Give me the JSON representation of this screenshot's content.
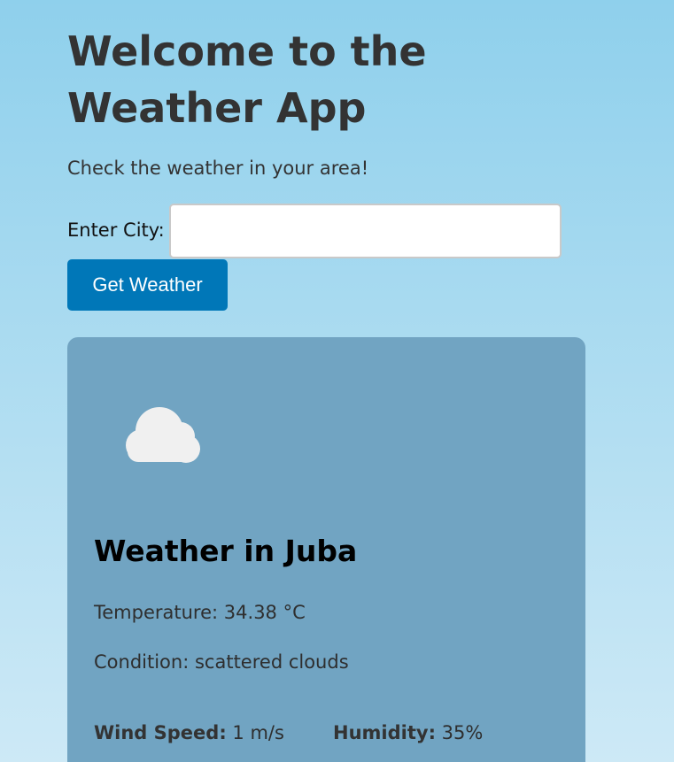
{
  "header": {
    "title": "Welcome to the Weather App",
    "subtitle": "Check the weather in your area!"
  },
  "search": {
    "label": "Enter City:",
    "value": "",
    "placeholder": "",
    "button_label": "Get Weather"
  },
  "weather": {
    "icon": "cloud-icon",
    "city_title": "Weather in Juba",
    "temperature_label": "Temperature:",
    "temperature_value": "34.38 °C",
    "condition_label": "Condition:",
    "condition_value": "scattered clouds",
    "wind_label": "Wind Speed:",
    "wind_value": "1 m/s",
    "humidity_label": "Humidity:",
    "humidity_value": "35%"
  },
  "colors": {
    "background_top": "#8fd0ec",
    "background_bottom": "#cde9f6",
    "button": "#0077b8",
    "card": "#71a4c2",
    "cloud": "#f0f0f0"
  }
}
